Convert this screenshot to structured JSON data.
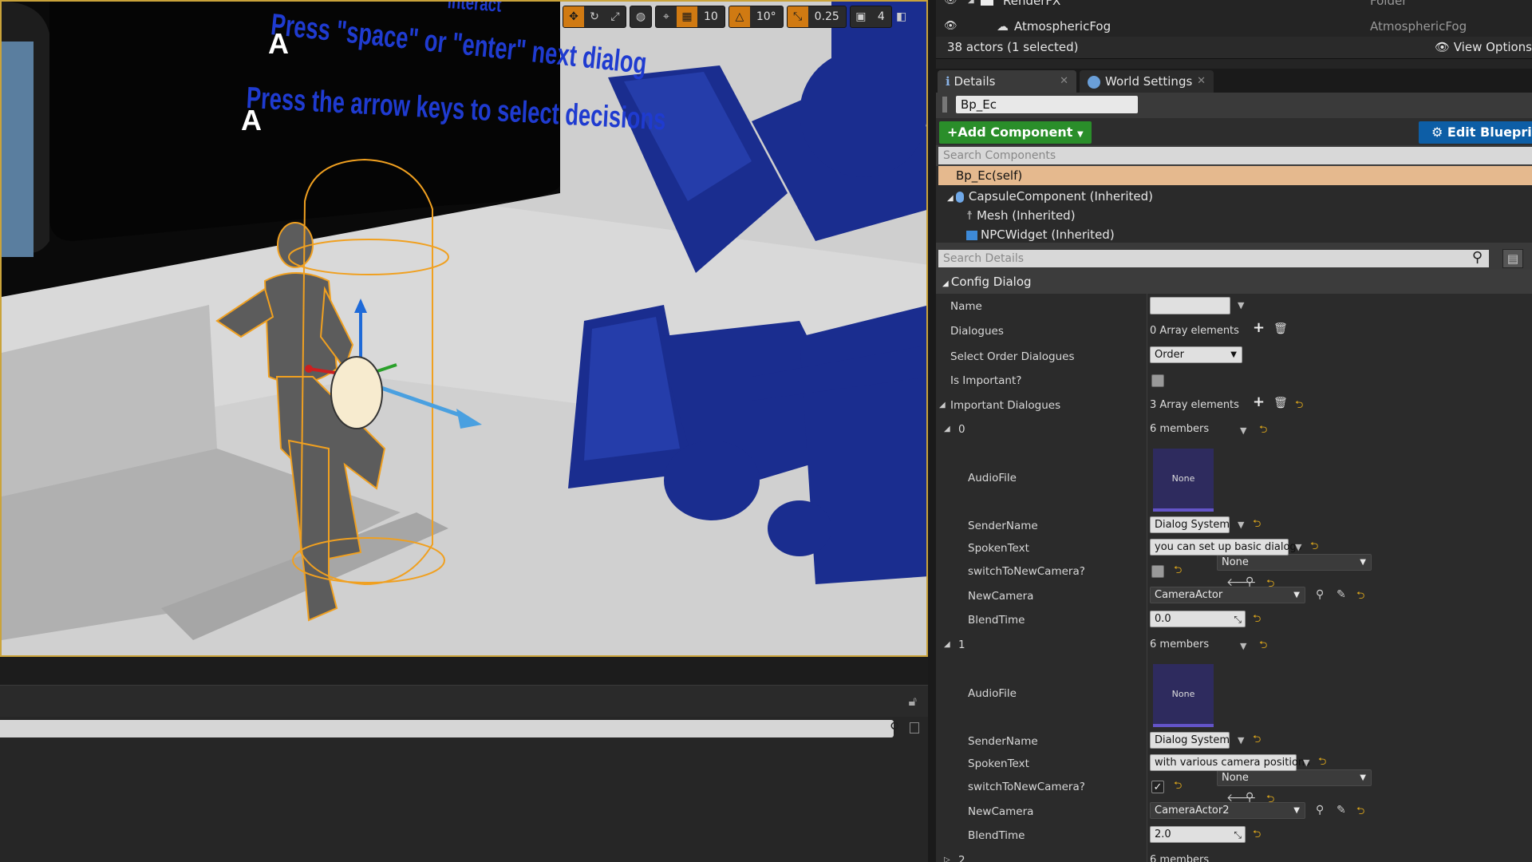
{
  "viewport": {
    "overlay_text_top": "interact",
    "overlay_text_1": "Press \"space\" or \"enter\" next dialog",
    "overlay_text_2": "Press the arrow keys to select decisions",
    "actor_glyph": "A",
    "toolbar": {
      "grid_snap_value": "10",
      "rotation_snap_value": "10°",
      "scale_snap_value": "0.25",
      "camera_speed_value": "4",
      "icons": [
        "translate-icon",
        "rotate-icon",
        "scale-icon",
        "world-icon",
        "surface-snap-icon",
        "grid-icon",
        "angle-icon",
        "scale-snap-icon",
        "camera-speed-icon",
        "maximize-icon"
      ],
      "accent_color": "#d07a12"
    },
    "selection_color": "#f0a020"
  },
  "outliner": {
    "rows": [
      {
        "name": "RenderFX",
        "type": "Folder"
      },
      {
        "name": "AtmosphericFog",
        "type": "AtmosphericFog"
      }
    ],
    "actor_count": "38 actors (1 selected)",
    "view_options": "View Options"
  },
  "tabs": [
    {
      "label": "Details"
    },
    {
      "label": "World Settings"
    }
  ],
  "details": {
    "actor_name": "Bp_Ec",
    "add_component": "Add Component",
    "edit_blueprint": "Edit Blueprint",
    "search_components_placeholder": "Search Components",
    "search_details_placeholder": "Search Details",
    "components": {
      "self": "Bp_Ec(self)",
      "capsule": "CapsuleComponent (Inherited)",
      "mesh": "Mesh (Inherited)",
      "widget": "NPCWidget (Inherited)"
    },
    "category": "Config Dialog",
    "props": {
      "name_label": "Name",
      "dialogues_label": "Dialogues",
      "dialogues_value": "0 Array elements",
      "select_order_label": "Select Order Dialogues",
      "select_order_value": "Order",
      "is_important_label": "Is Important?",
      "important_dialogues_label": "Important Dialogues",
      "important_dialogues_value": "3 Array elements"
    },
    "elements": [
      {
        "index": "0",
        "members": "6 members",
        "audio_label": "AudioFile",
        "thumb": "None",
        "audio_value": "None",
        "sender_label": "SenderName",
        "sender_value": "Dialog System",
        "spoken_label": "SpokenText",
        "spoken_value": "you can set up basic dialogs",
        "switch_label": "switchToNewCamera?",
        "switch_checked": false,
        "camera_label": "NewCamera",
        "camera_value": "CameraActor",
        "blend_label": "BlendTime",
        "blend_value": "0.0"
      },
      {
        "index": "1",
        "members": "6 members",
        "audio_label": "AudioFile",
        "thumb": "None",
        "audio_value": "None",
        "sender_label": "SenderName",
        "sender_value": "Dialog System",
        "spoken_label": "SpokenText",
        "spoken_value": "with various camera positions",
        "switch_label": "switchToNewCamera?",
        "switch_checked": true,
        "camera_label": "NewCamera",
        "camera_value": "CameraActor2",
        "blend_label": "BlendTime",
        "blend_value": "2.0"
      },
      {
        "index": "2",
        "members": "6 members"
      }
    ]
  }
}
